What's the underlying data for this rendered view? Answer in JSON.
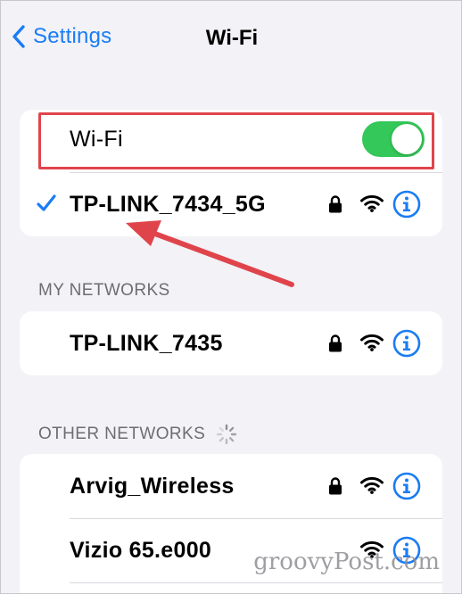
{
  "nav": {
    "back_label": "Settings",
    "title": "Wi-Fi"
  },
  "wifi_toggle": {
    "label": "Wi-Fi",
    "enabled": true
  },
  "connected_network": {
    "name": "TP-LINK_7434_5G",
    "secured": true,
    "connected": true
  },
  "my_networks": {
    "header": "MY NETWORKS",
    "items": [
      {
        "name": "TP-LINK_7435",
        "secured": true
      }
    ]
  },
  "other_networks": {
    "header": "OTHER NETWORKS",
    "items": [
      {
        "name": "Arvig_Wireless",
        "secured": true
      },
      {
        "name": "Vizio 65.e000",
        "secured": false
      }
    ]
  },
  "watermark": "groovyPost.com",
  "colors": {
    "accent": "#1a7cf5",
    "toggle_on": "#34c759",
    "annotation": "#e0444b",
    "background": "#f2f2f7"
  }
}
